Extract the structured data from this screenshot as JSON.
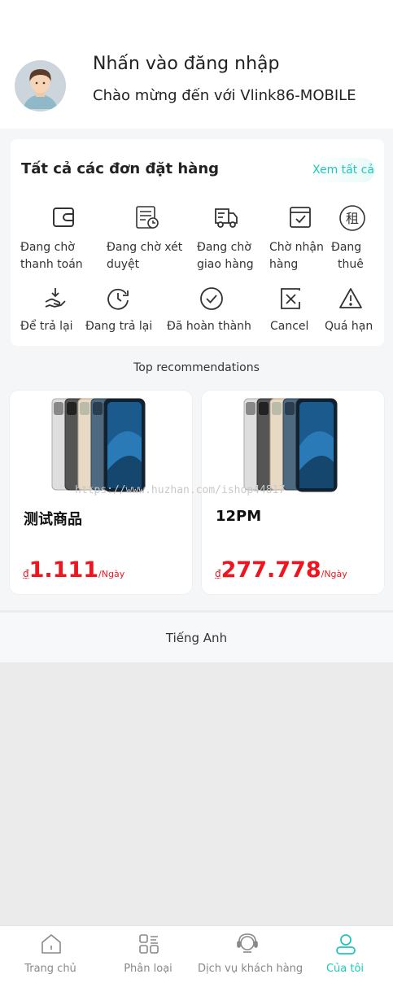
{
  "profile": {
    "login_prompt": "Nhấn vào đăng nhập",
    "welcome": "Chào mừng đến với Vlink86-MOBILE",
    "avatar_icon": "user-avatar-icon"
  },
  "orders": {
    "title": "Tất cả các đơn đặt hàng",
    "view_all": "Xem tất cả",
    "accent_color": "#1ec8b8",
    "row1": [
      {
        "icon": "wallet-icon",
        "label_1": "Đang chờ",
        "label_2": "thanh toán"
      },
      {
        "icon": "review-document-icon",
        "label_1": "Đang chờ xét",
        "label_2": "duyệt"
      },
      {
        "icon": "delivery-truck-icon",
        "label_1": "Đang chờ",
        "label_2": "giao hàng"
      },
      {
        "icon": "receive-box-icon",
        "label_1": "Chờ nhận",
        "label_2": "hàng"
      },
      {
        "icon": "rent-icon",
        "label_1": "Đang",
        "label_2": "thuê"
      }
    ],
    "row2": [
      {
        "icon": "return-hand-icon",
        "label": "Để trả lại"
      },
      {
        "icon": "clock-return-icon",
        "label": "Đang trả lại"
      },
      {
        "icon": "check-circle-icon",
        "label": "Đã hoàn thành"
      },
      {
        "icon": "cancel-icon",
        "label": "Cancel"
      },
      {
        "icon": "warning-icon",
        "label": "Quá hạn"
      }
    ]
  },
  "recommendations": {
    "title": "Top recommendations",
    "products": [
      {
        "name": "测试商品",
        "currency": "₫",
        "price": "1.111",
        "unit": "/Ngày"
      },
      {
        "name": "12PM",
        "currency": "₫",
        "price": "277.778",
        "unit": "/Ngày"
      }
    ],
    "price_color": "#f0141e"
  },
  "watermark": "https://www.huzhan.com/ishop44817",
  "language": {
    "label": "Tiếng Anh"
  },
  "tabbar": {
    "items": [
      {
        "label": "Trang chủ",
        "icon": "home-icon"
      },
      {
        "label": "Phân loại",
        "icon": "category-icon"
      },
      {
        "label": "Dịch vụ khách hàng",
        "icon": "headset-icon"
      },
      {
        "label": "Của tôi",
        "icon": "user-icon",
        "active": true
      }
    ]
  }
}
